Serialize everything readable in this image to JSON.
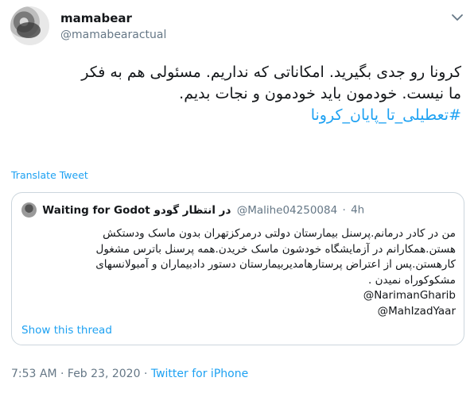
{
  "author": {
    "display_name": "mamabear",
    "handle": "@mamabearactual"
  },
  "tweet": {
    "line1": "کرونا رو جدی بگیرید. امکاناتی که نداریم. مسئولی هم به فکر",
    "line2": "ما نیست. خودمون باید خودمون و نجات بدیم.",
    "hashtag": "#تعطیلی_تا_پایان_کرونا"
  },
  "translate_label": "Translate Tweet",
  "quoted": {
    "display_name": "Waiting for Godot در انتظار گودو",
    "handle": "@Malihe04250084",
    "separator": "·",
    "time": "4h",
    "line1": "من در کادر درمانم.پرسنل بیمارستان دولتی درمرکزتهران بدون ماسک ودستکش",
    "line2": "هستن.همکارانم در آزمایشگاه خودشون ماسک خریدن.همه پرسنل باترس مشغول",
    "line3": "کارهستن.پس از اعتراض پرستارهامدیربیمارستان دستور دادبیماران و آمبولانسهای",
    "line4": "مشکوکوراه نمیدن .",
    "mention1": "@NarimanGharib",
    "mention2": "@MahIzadYaar",
    "show_thread": "Show this thread"
  },
  "meta": {
    "time": "7:53 AM",
    "separator": "·",
    "date": "Feb 23, 2020",
    "source": "Twitter for iPhone"
  },
  "icons": {
    "more": "chevron-down-icon",
    "avatar": "profile-photo"
  },
  "colors": {
    "accent": "#1da1f2",
    "secondary_text": "#657786",
    "border": "#ccd6dd"
  }
}
